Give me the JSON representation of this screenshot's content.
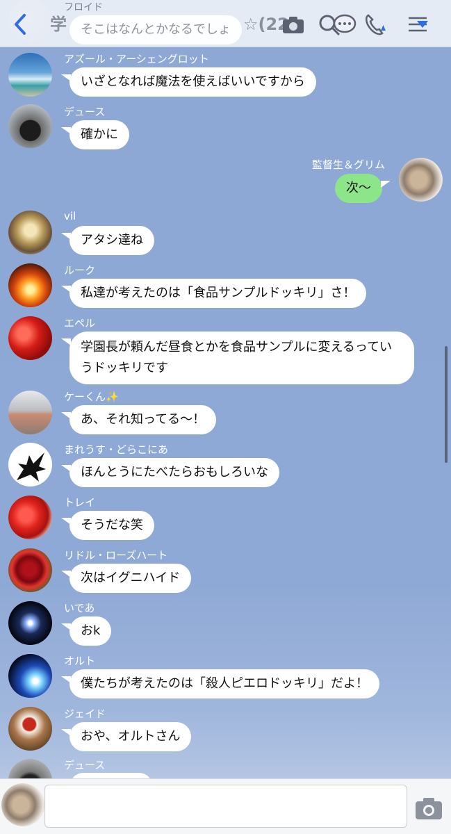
{
  "header": {
    "title": "学",
    "member_count": "☆(22)",
    "peek_sender": "フロイド",
    "peek_message": "そこはなんとかなるでしょ"
  },
  "messages": [
    {
      "sender": "アズール・アーシェングロット",
      "text": "いざとなれば魔法を使えばいいですから"
    },
    {
      "sender": "デュース",
      "text": "確かに"
    },
    {
      "sender": "監督生＆グリム",
      "text": "次〜",
      "self": true
    },
    {
      "sender": "vil",
      "text": "アタシ達ね"
    },
    {
      "sender": "ルーク",
      "text": "私達が考えたのは「食品サンプルドッキリ」さ！"
    },
    {
      "sender": "エペル",
      "text": "学園長が頼んだ昼食とかを食品サンプルに変えるっていうドッキリです"
    },
    {
      "sender": "ケーくん✨",
      "text": "あ、それ知ってる〜！"
    },
    {
      "sender": "まれうす・どらこにあ",
      "text": "ほんとうにたべたらおもしろいな"
    },
    {
      "sender": "トレイ",
      "text": "そうだな笑"
    },
    {
      "sender": "リドル・ローズハート",
      "text": "次はイグニハイド"
    },
    {
      "sender": "いであ",
      "text": "おk"
    },
    {
      "sender": "オルト",
      "text": "僕たちが考えたのは「殺人ピエロドッキリ」だよ！"
    },
    {
      "sender": "ジェイド",
      "text": "おや、オルトさん"
    },
    {
      "sender": "デュース",
      "text": ""
    }
  ],
  "input": {
    "placeholder": "",
    "value": ""
  },
  "icons": {
    "back": "chevron-left-icon",
    "search": "search-icon",
    "chat_bubble": "chat-bubble-icon",
    "phone": "phone-icon",
    "menu": "menu-icon",
    "camera": "camera-icon"
  },
  "colors": {
    "accent": "#2f6ee0",
    "self_bubble": "#8de58a",
    "background": "#8ea8d4"
  }
}
